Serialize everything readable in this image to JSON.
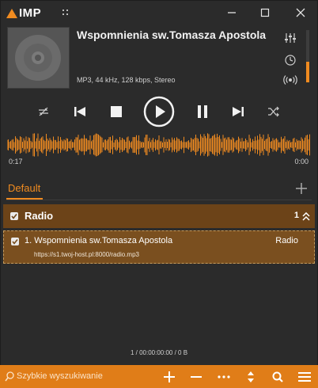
{
  "app": {
    "logo_text": "IMP",
    "accent": "#f08b20"
  },
  "track": {
    "title": "Wspomnienia sw.Tomasza Apostola",
    "info": "MP3, 44 kHz, 128 kbps, Stereo"
  },
  "side_icons": [
    "equalizer-icon",
    "clock-icon",
    "broadcast-icon"
  ],
  "volume_level": 0.4,
  "controls": [
    "repeat-icon",
    "previous-icon",
    "stop-icon",
    "play-icon",
    "pause-icon",
    "next-icon",
    "shuffle-icon"
  ],
  "time": {
    "elapsed": "0:17",
    "remaining": "0:00"
  },
  "playlist": {
    "tab_label": "Default",
    "group": {
      "label": "Radio",
      "count": "1"
    },
    "items": [
      {
        "title": "1. Wspomnienia sw.Tomasza Apostola",
        "url": "https://s1.twoj-host.pl:8000/radio.mp3",
        "source": "Radio"
      }
    ],
    "summary": "1 / 00:00:00:00 / 0 B"
  },
  "search": {
    "placeholder": "Szybkie wyszukiwanie"
  },
  "bottom_buttons": [
    "add-icon",
    "remove-icon",
    "more-icon",
    "sort-icon",
    "search-icon",
    "menu-icon"
  ]
}
